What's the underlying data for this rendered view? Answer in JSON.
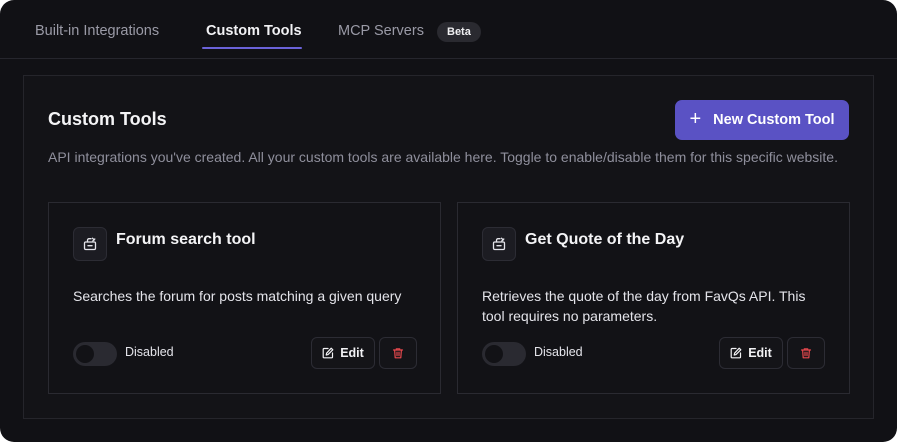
{
  "tabs": [
    {
      "label": "Built-in Integrations",
      "active": false
    },
    {
      "label": "Custom Tools",
      "active": true
    },
    {
      "label": "MCP Servers",
      "active": false,
      "badge": "Beta"
    }
  ],
  "section": {
    "title": "Custom Tools",
    "new_button_label": "New Custom Tool",
    "new_button_icon": "plus-icon",
    "description": "API integrations you've created. All your custom tools are available here. Toggle to enable/disable them for this specific website."
  },
  "tools": [
    {
      "icon": "tool-icon",
      "name": "Forum search tool",
      "description": "Searches the forum for posts matching a given query",
      "enabled": false,
      "status_label": "Disabled",
      "edit_label": "Edit"
    },
    {
      "icon": "tool-icon",
      "name": "Get Quote of the Day",
      "description": "Retrieves the quote of the day from FavQs API. This tool requires no parameters.",
      "enabled": false,
      "status_label": "Disabled",
      "edit_label": "Edit"
    }
  ],
  "colors": {
    "background": "#111115",
    "accent": "#5a52c4",
    "tab_underline": "#6b63d9",
    "delete": "#e5484d"
  }
}
